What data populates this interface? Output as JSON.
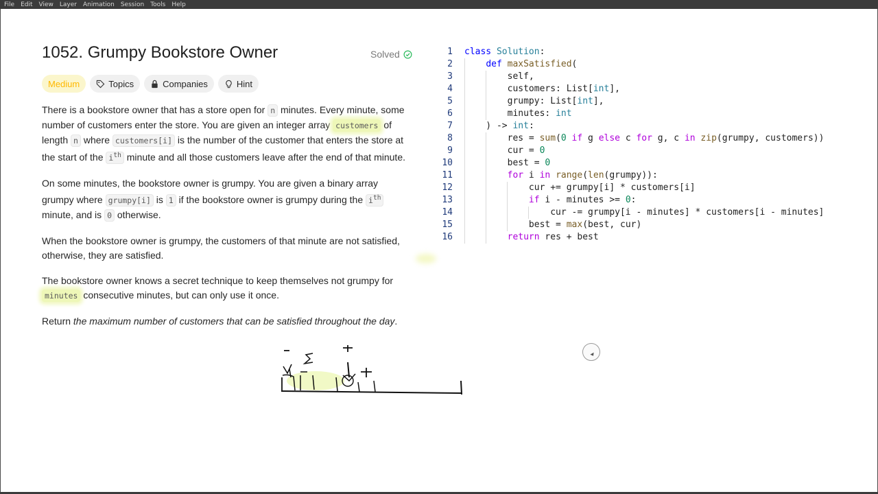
{
  "menu": [
    "File",
    "Edit",
    "View",
    "Layer",
    "Animation",
    "Session",
    "Tools",
    "Help"
  ],
  "problem": {
    "title": "1052. Grumpy Bookstore Owner",
    "status": "Solved",
    "tags": [
      {
        "label": "Medium",
        "icon": "none"
      },
      {
        "label": "Topics",
        "icon": "tag-icon"
      },
      {
        "label": "Companies",
        "icon": "lock-icon"
      },
      {
        "label": "Hint",
        "icon": "lightbulb-icon"
      }
    ],
    "p1": {
      "t1": "There is a bookstore owner that has a store open for ",
      "c1": "n",
      "t2": " minutes. Every minute, some number of customers enter the store. You are given an integer array ",
      "c2": "customers",
      "t3": " of length ",
      "c3": "n",
      "t4": " where ",
      "c4": "customers[i]",
      "t5": " is the number of the customer that enters the store at the start of the ",
      "c5": "i",
      "sup": "th",
      "t6": " minute and all those customers leave after the end of that minute."
    },
    "p2": {
      "t1": "On some minutes, the bookstore owner is grumpy. You are given a binary array grumpy where ",
      "c1": "grumpy[i]",
      "t2": " is ",
      "c2": "1",
      "t3": " if the bookstore owner is grumpy during the ",
      "c3": "i",
      "sup": "th",
      "t4": " minute, and is ",
      "c4": "0",
      "t5": " otherwise."
    },
    "p3": "When the bookstore owner is grumpy, the customers of that minute are not satisfied, otherwise, they are satisfied.",
    "p4": {
      "t1": "The bookstore owner knows a secret technique to keep themselves not grumpy for ",
      "c1": "minutes",
      "t2": " consecutive minutes, but can only use it once."
    },
    "p5": {
      "t1": "Return ",
      "em": "the maximum number of customers that can be satisfied throughout the day",
      "t2": "."
    }
  },
  "code_numbers": [
    "1",
    "2",
    "3",
    "4",
    "5",
    "6",
    "7",
    "8",
    "9",
    "10",
    "11",
    "12",
    "13",
    "14",
    "15",
    "16"
  ],
  "colors": {
    "medium": "#ffb800",
    "solved_check": "#2cbb5d",
    "highlight": "#eef7b8"
  }
}
